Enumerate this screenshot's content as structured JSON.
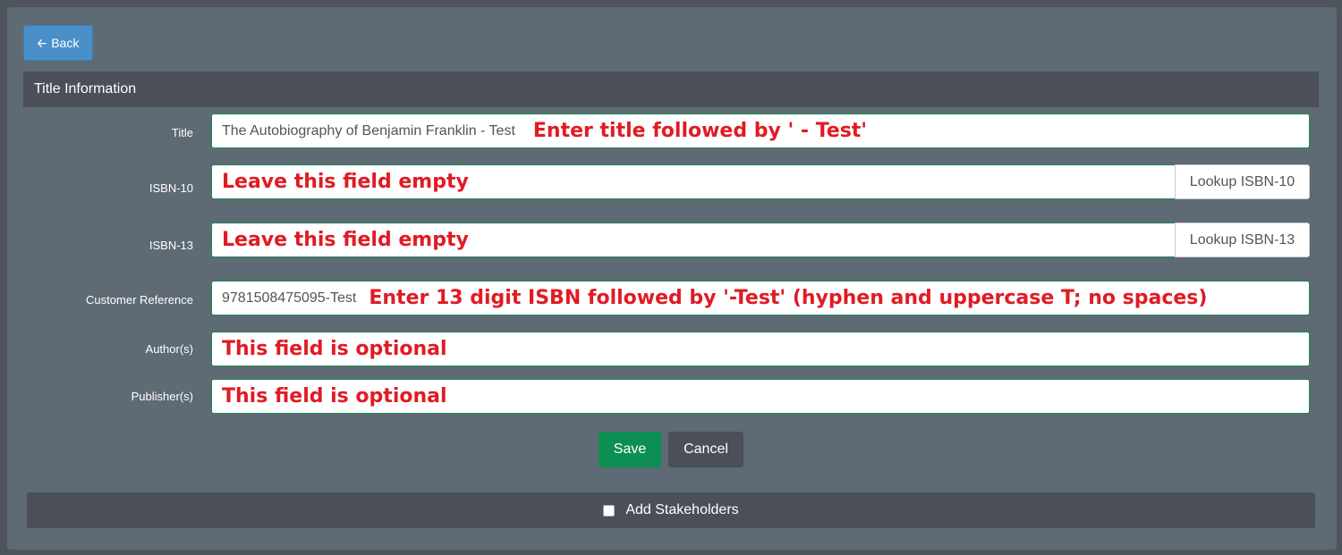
{
  "back_button": {
    "label": "Back",
    "icon": "arrow-left-icon"
  },
  "section": {
    "title": "Title Information"
  },
  "fields": {
    "title": {
      "label": "Title",
      "value": "The Autobiography of Benjamin Franklin - Test",
      "note": "Enter title followed by ' - Test'"
    },
    "isbn10": {
      "label": "ISBN-10",
      "value": "",
      "note": "Leave this field empty",
      "lookup": "Lookup ISBN-10"
    },
    "isbn13": {
      "label": "ISBN-13",
      "value": "",
      "note": "Leave this field empty",
      "lookup": "Lookup ISBN-13"
    },
    "customer_ref": {
      "label": "Customer Reference",
      "value": "9781508475095-Test",
      "note": "Enter 13 digit ISBN followed by '-Test' (hyphen and uppercase T; no spaces)"
    },
    "authors": {
      "label": "Author(s)",
      "value": "",
      "note": "This field is optional"
    },
    "publishers": {
      "label": "Publisher(s)",
      "value": "",
      "note": "This field is optional"
    }
  },
  "actions": {
    "save": "Save",
    "cancel": "Cancel"
  },
  "stakeholders": {
    "label": "Add Stakeholders",
    "checked": false
  },
  "colors": {
    "primary": "#4a8fc7",
    "success": "#0c8f52",
    "dark": "#4b4f57",
    "annotation": "#e01b24",
    "field_border": "#1a8a55"
  }
}
